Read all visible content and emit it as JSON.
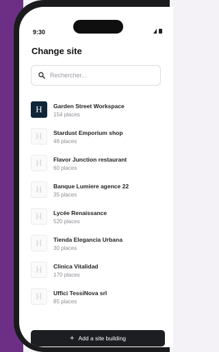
{
  "status_bar": {
    "time": "9:30"
  },
  "header": {
    "title": "Change site"
  },
  "search": {
    "placeholder": "Rechercher..."
  },
  "sites": [
    {
      "name": "Garden Street Workspace",
      "places": "154 places",
      "logo": "H",
      "active": true
    },
    {
      "name": "Stardust Emporium shop",
      "places": "46 places",
      "logo": "H",
      "active": false
    },
    {
      "name": "Flavor Junction restaurant",
      "places": "60 places",
      "logo": "H",
      "active": false
    },
    {
      "name": "Banque Lumiere agence 22",
      "places": "35 places",
      "logo": "H",
      "active": false
    },
    {
      "name": "Lycée Renaissance",
      "places": "520 places",
      "logo": "H",
      "active": false
    },
    {
      "name": "Tienda Elegancia Urbana",
      "places": "30 places",
      "logo": "H",
      "active": false
    },
    {
      "name": "Clinica Vitalidad",
      "places": "170 places",
      "logo": "H",
      "active": false
    },
    {
      "name": "Uffici TessiNova srl",
      "places": "85 places",
      "logo": "H",
      "active": false
    }
  ],
  "footer": {
    "add_button": "Add a site building",
    "add_icon": "+"
  },
  "colors": {
    "brand_purple": "#6d2f86",
    "active_logo": "#0f2539",
    "button_dark": "#1d1e22"
  }
}
